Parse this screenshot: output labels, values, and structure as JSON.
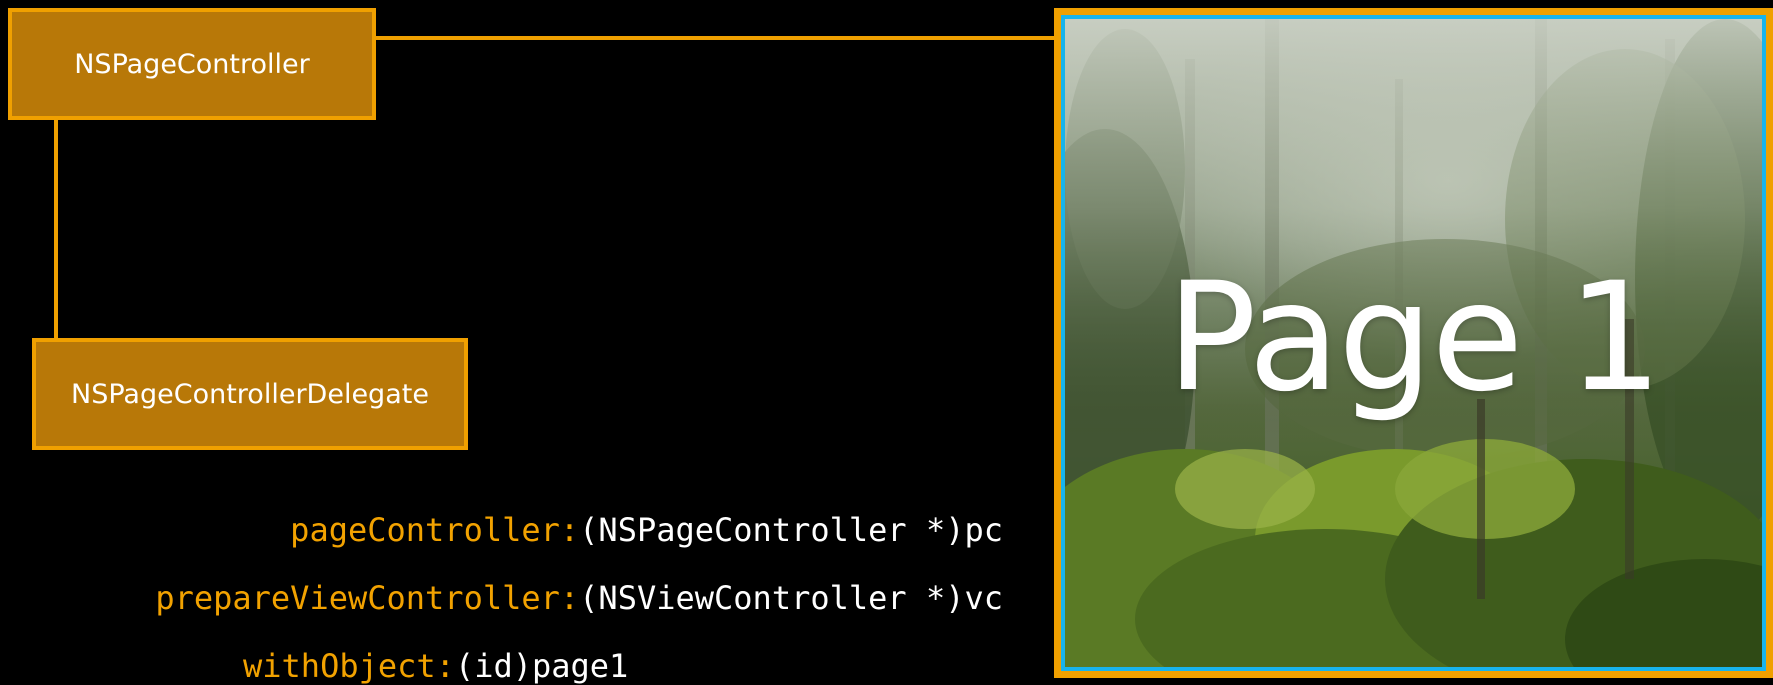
{
  "diagram": {
    "page_controller_label": "NSPageController",
    "delegate_label": "NSPageControllerDelegate"
  },
  "code": {
    "line1": {
      "selector": "pageController:",
      "argument": "(NSPageController *)pc"
    },
    "line2": {
      "selector": "prepareViewController:",
      "argument": "(NSViewController *)vc"
    },
    "line3": {
      "selector": "withObject:",
      "argument": "(id)page1"
    }
  },
  "preview": {
    "page_label": "Page 1"
  },
  "colors": {
    "box_fill": "#b87808",
    "box_border": "#f0a000",
    "selector_text": "#f2a200",
    "argument_text": "#ffffff",
    "preview_border": "#18b4ec",
    "background": "#000000"
  }
}
